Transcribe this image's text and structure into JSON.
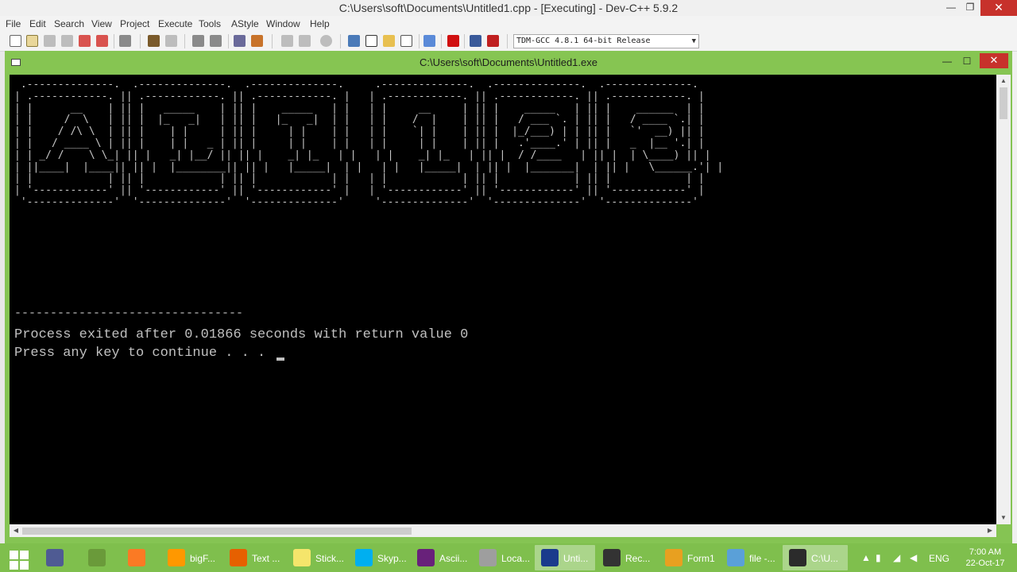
{
  "ide": {
    "title": "C:\\Users\\soft\\Documents\\Untitled1.cpp - [Executing] - Dev-C++ 5.9.2",
    "controls": {
      "minimize": "—",
      "maximize": "❐",
      "close": "✕"
    },
    "menu": [
      "File",
      "Edit",
      "Search",
      "View",
      "Project",
      "Execute",
      "Tools",
      "AStyle",
      "Window",
      "Help"
    ],
    "compiler": "TDM-GCC 4.8.1 64-bit Release"
  },
  "console": {
    "title": "C:\\Users\\soft\\Documents\\Untitled1.exe",
    "controls": {
      "minimize": "—",
      "maximize": "☐",
      "close": "✕"
    },
    "ascii_art": " .--------------.  .--------------.  .--------------.     .--------------.  .--------------.  .--------------.\n| .------------. || .------------. || .------------. |   | .------------. || .------------. || .------------. |\n| |      __    | || |   _____    | || |    _____   | |   | |     __     | || |    _____   | || |    ______  | |\n| |     /  \\   | || |  |_   _|   | || |   |_   _|  | |   | |    /  |    | || |   / ___ `. | || |   / ____ `.| |\n| |    / /\\ \\  | || |    | |     | || |     | |    | |   | |    `| |    | || |  |_/___) | | || |   `'  __) || |\n| |   / ____ \\ | || |    | |   _ | || |     | |    | |   | |     | |    | || |   .'____.' | || |   _  |__ '.| |\n| | _/ /    \\ \\_| || |   _| |__/ || || |    _| |_   | |   | |    _| |_   | || |  / /____   | || |  | \\____) || |\n| ||____|  |____|| || |  |________|| || |   |_____|  | |   | |   |_____|  | || |  |_______|  | || |   \\______.'| |\n| |            | || |            | || |            | |   | |            | || |            | || |            | |\n| '------------' || '------------' || '------------' |   | '------------' || '------------' || '------------' |\n '--------------'  '--------------'  '--------------'     '--------------'  '--------------'  '--------------'",
    "divider": "--------------------------------",
    "exit_message": "Process exited after 0.01866 seconds with return value 0",
    "press_message": "Press any key to continue . . . "
  },
  "taskbar": {
    "apps": [
      {
        "name": "php",
        "label": "",
        "color": "#4f5b93"
      },
      {
        "name": "android-studio",
        "label": "",
        "color": "#6a9a3a"
      },
      {
        "name": "xampp",
        "label": "",
        "color": "#fb7a24"
      },
      {
        "name": "sublime",
        "label": "bigF...",
        "color": "#ff9800"
      },
      {
        "name": "firefox",
        "label": "Text ...",
        "color": "#e66000"
      },
      {
        "name": "sticky-notes",
        "label": "Stick...",
        "color": "#f5e56b"
      },
      {
        "name": "skype",
        "label": "Skyp...",
        "color": "#00aff0"
      },
      {
        "name": "visual-studio",
        "label": "Ascii...",
        "color": "#68217a"
      },
      {
        "name": "drive",
        "label": "Loca...",
        "color": "#9e9e9e"
      },
      {
        "name": "dev-cpp",
        "label": "Unti...",
        "color": "#1a3b8c"
      },
      {
        "name": "recorder",
        "label": "Rec...",
        "color": "#333333"
      },
      {
        "name": "form",
        "label": "Form1",
        "color": "#e8a020"
      },
      {
        "name": "file",
        "label": "file -...",
        "color": "#5aa0d8"
      },
      {
        "name": "console",
        "label": "C:\\U...",
        "color": "#2b2b2b"
      }
    ],
    "language": "ENG",
    "time": "7:00 AM",
    "date": "22-Oct-17"
  }
}
